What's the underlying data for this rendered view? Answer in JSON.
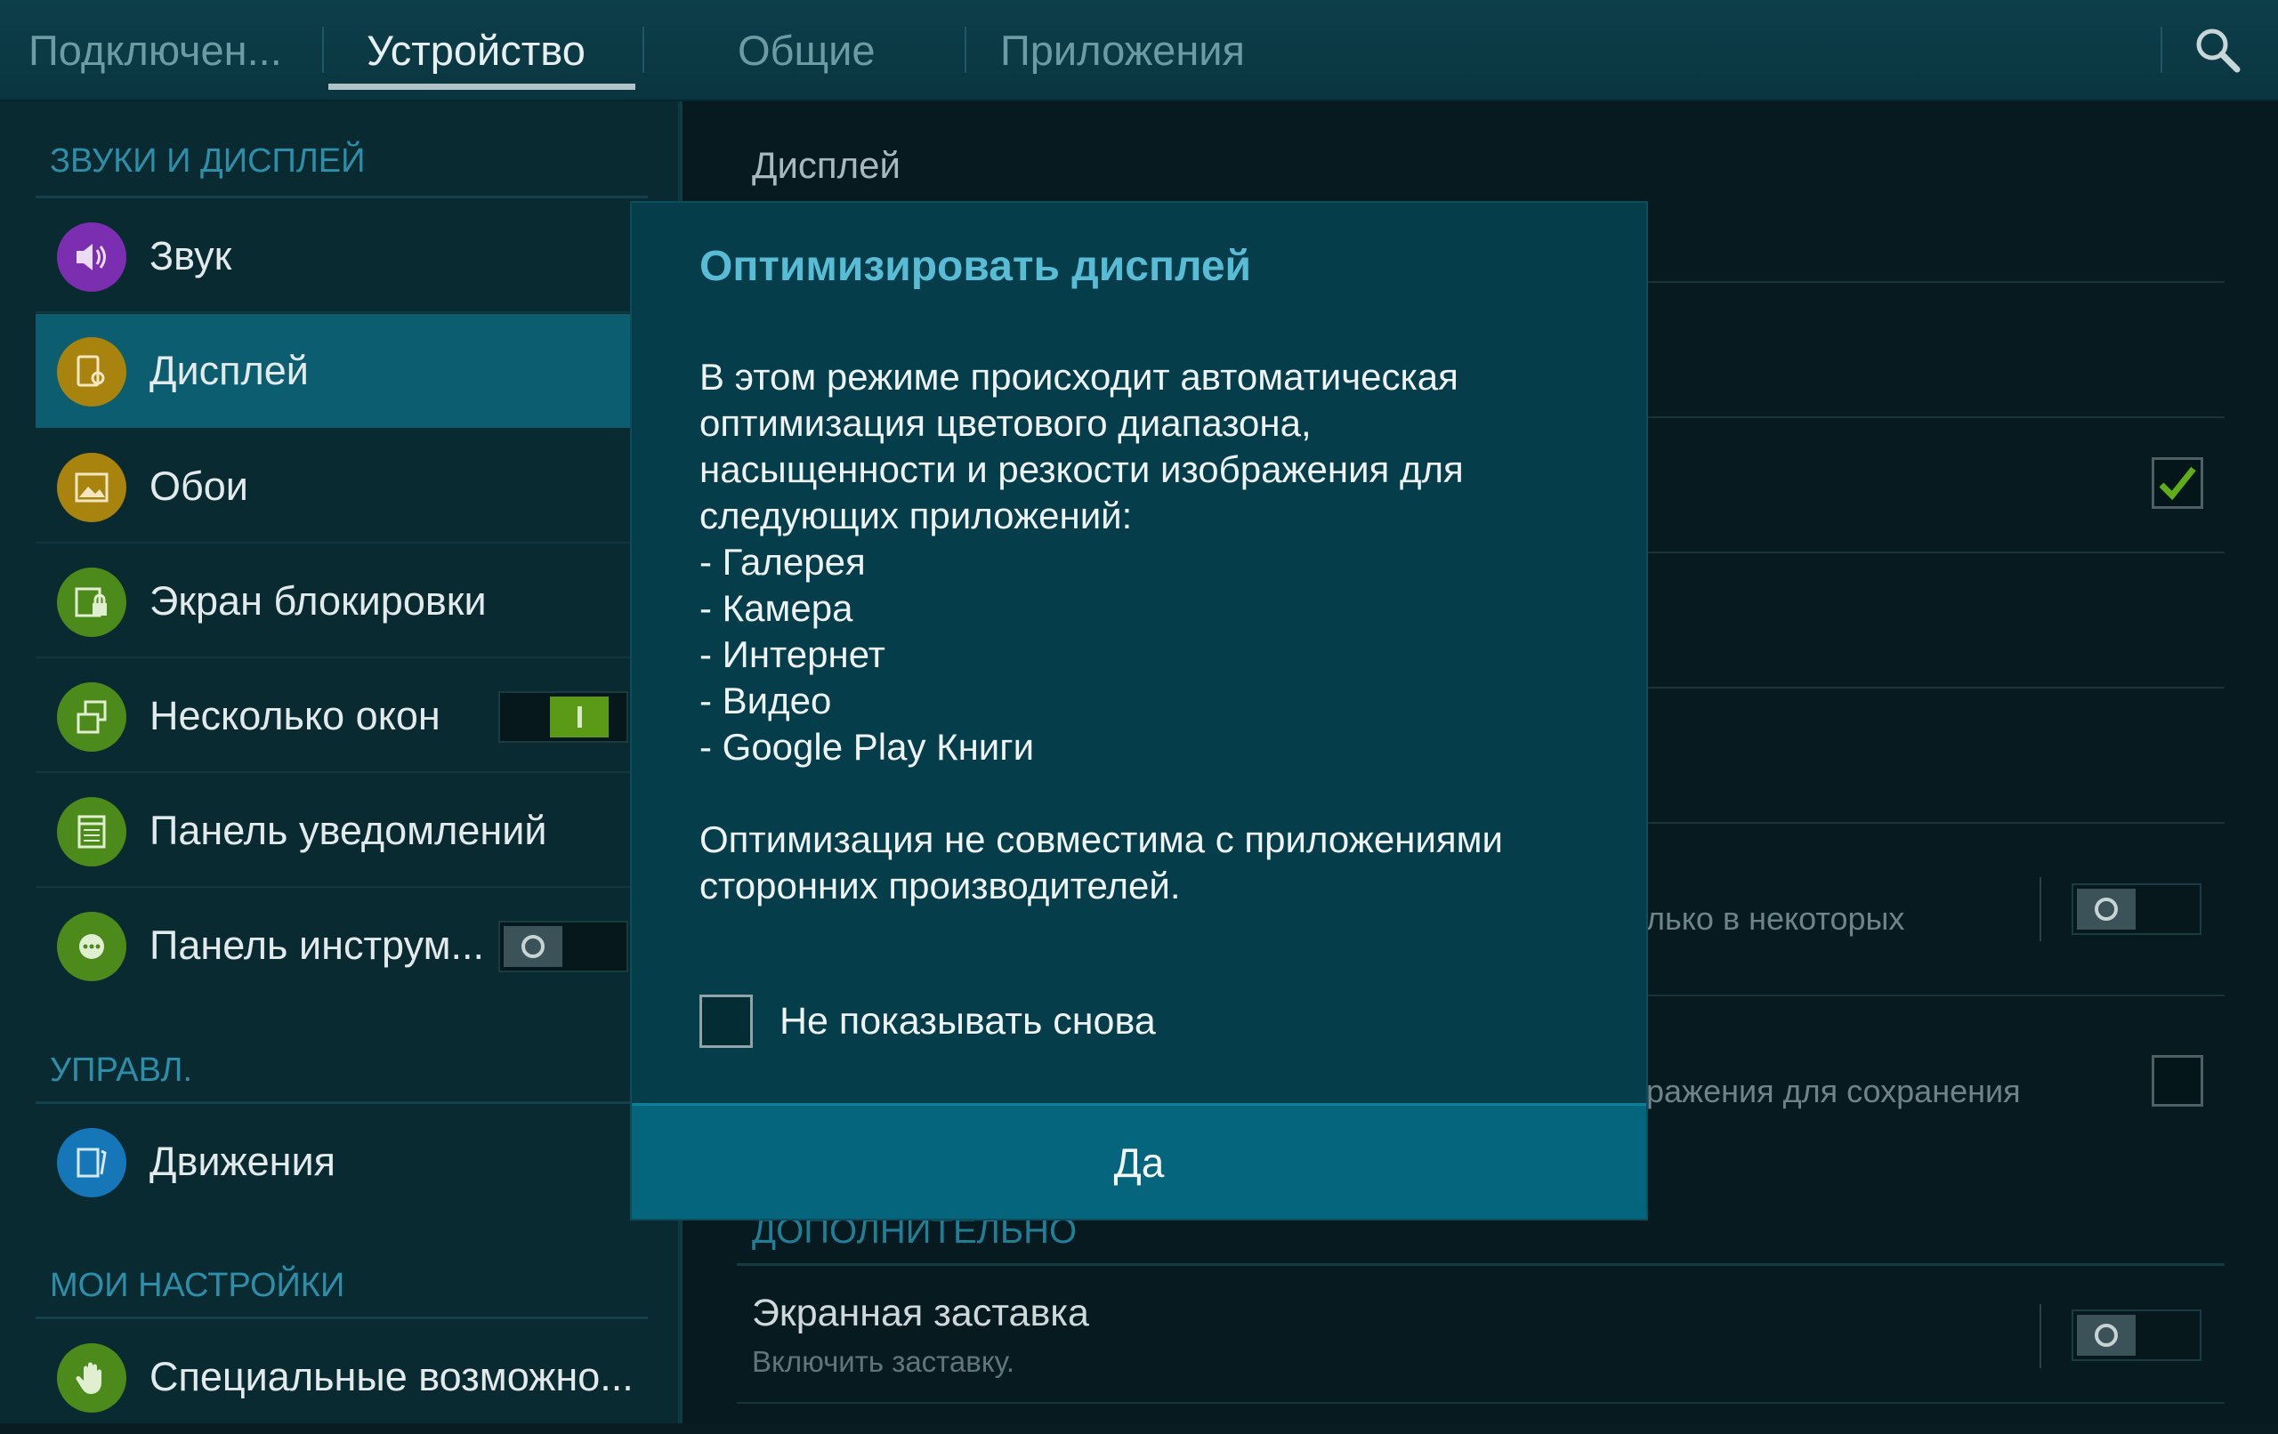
{
  "tabs": [
    {
      "label": "Подключен..."
    },
    {
      "label": "Устройство"
    },
    {
      "label": "Общие"
    },
    {
      "label": "Приложения"
    }
  ],
  "active_tab": "Устройство",
  "sidebar": {
    "sections": [
      {
        "header": "ЗВУКИ И ДИСПЛЕЙ"
      },
      {
        "header": "УПРАВЛ."
      },
      {
        "header": "МОИ НАСТРОЙКИ"
      }
    ],
    "items": [
      {
        "label": "Звук",
        "icon": "speaker-icon",
        "color": "#7b2fb0"
      },
      {
        "label": "Дисплей",
        "icon": "display-icon",
        "color": "#a8830e"
      },
      {
        "label": "Обои",
        "icon": "wallpaper-icon",
        "color": "#a8830e"
      },
      {
        "label": "Экран блокировки",
        "icon": "lock-screen-icon",
        "color": "#4d8a1c"
      },
      {
        "label": "Несколько окон",
        "icon": "multi-window-icon",
        "color": "#4d8a1c",
        "toggle": "on"
      },
      {
        "label": "Панель уведомлений",
        "icon": "notification-panel-icon",
        "color": "#4d8a1c"
      },
      {
        "label": "Панель инструм...",
        "icon": "toolbox-icon",
        "color": "#4d8a1c",
        "toggle": "off"
      },
      {
        "label": "Движения",
        "icon": "motion-icon",
        "color": "#1576b8"
      },
      {
        "label": "Специальные возможно...",
        "icon": "accessibility-hand-icon",
        "color": "#4d8a1c"
      }
    ],
    "selected": "Дисплей"
  },
  "content": {
    "title": "Дисплей",
    "partial_text_1": "лько в некоторых",
    "partial_text_2": "ражения для сохранения",
    "advanced_header": "ДОПОЛНИТЕЛЬНО",
    "screensaver_title": "Экранная заставка",
    "screensaver_subtitle": "Включить заставку."
  },
  "dialog": {
    "title": "Оптимизировать дисплей",
    "body_lines": [
      "В этом режиме происходит автоматическая",
      "оптимизация цветового диапазона,",
      "насыщенности и резкости изображения для",
      "следующих приложений:",
      "- Галерея",
      "- Камера",
      "- Интернет",
      "- Видео",
      "- Google Play Книги"
    ],
    "body_note_lines": [
      "Оптимизация не совместима с приложениями",
      "сторонних производителей."
    ],
    "checkbox_label": "Не показывать снова",
    "checkbox_checked": false,
    "ok_button": "Да"
  }
}
